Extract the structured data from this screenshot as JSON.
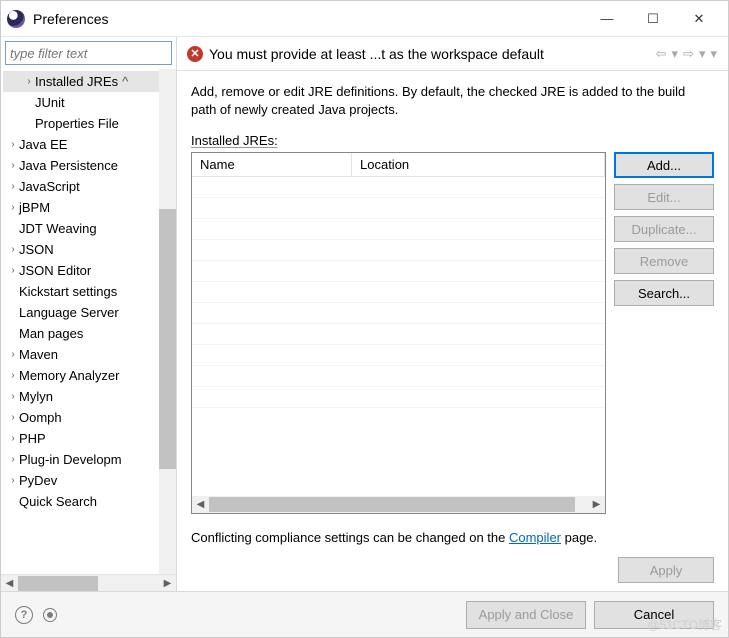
{
  "window": {
    "title": "Preferences"
  },
  "filter": {
    "placeholder": "type filter text"
  },
  "tree": {
    "items": [
      {
        "label": "Installed JREs",
        "level": 2,
        "expandable": true,
        "selected": true
      },
      {
        "label": "JUnit",
        "level": 2,
        "expandable": false
      },
      {
        "label": "Properties File",
        "level": 2,
        "expandable": false
      },
      {
        "label": "Java EE",
        "level": 1,
        "expandable": true
      },
      {
        "label": "Java Persistence",
        "level": 1,
        "expandable": true
      },
      {
        "label": "JavaScript",
        "level": 1,
        "expandable": true
      },
      {
        "label": "jBPM",
        "level": 1,
        "expandable": true
      },
      {
        "label": "JDT Weaving",
        "level": 1,
        "expandable": false
      },
      {
        "label": "JSON",
        "level": 1,
        "expandable": true
      },
      {
        "label": "JSON Editor",
        "level": 1,
        "expandable": true
      },
      {
        "label": "Kickstart settings",
        "level": 1,
        "expandable": false
      },
      {
        "label": "Language Server",
        "level": 1,
        "expandable": false
      },
      {
        "label": "Man pages",
        "level": 1,
        "expandable": false
      },
      {
        "label": "Maven",
        "level": 1,
        "expandable": true
      },
      {
        "label": "Memory Analyzer",
        "level": 1,
        "expandable": true
      },
      {
        "label": "Mylyn",
        "level": 1,
        "expandable": true
      },
      {
        "label": "Oomph",
        "level": 1,
        "expandable": true
      },
      {
        "label": "PHP",
        "level": 1,
        "expandable": true
      },
      {
        "label": "Plug-in Developm",
        "level": 1,
        "expandable": true
      },
      {
        "label": "PyDev",
        "level": 1,
        "expandable": true
      },
      {
        "label": "Quick Search",
        "level": 1,
        "expandable": false
      }
    ]
  },
  "header": {
    "error": "You must provide at least ...t as the workspace default"
  },
  "main": {
    "description": "Add, remove or edit JRE definitions. By default, the checked JRE is added to the build path of newly created Java projects.",
    "table_label": "Installed JREs:",
    "columns": {
      "name": "Name",
      "location": "Location"
    },
    "footer_text_pre": "Conflicting compliance settings can be changed on the ",
    "footer_link": "Compiler",
    "footer_text_post": " page."
  },
  "buttons": {
    "add": "Add...",
    "edit": "Edit...",
    "duplicate": "Duplicate...",
    "remove": "Remove",
    "search": "Search...",
    "apply": "Apply",
    "apply_close": "Apply and Close",
    "cancel": "Cancel"
  },
  "watermark": "@51CTO博客"
}
